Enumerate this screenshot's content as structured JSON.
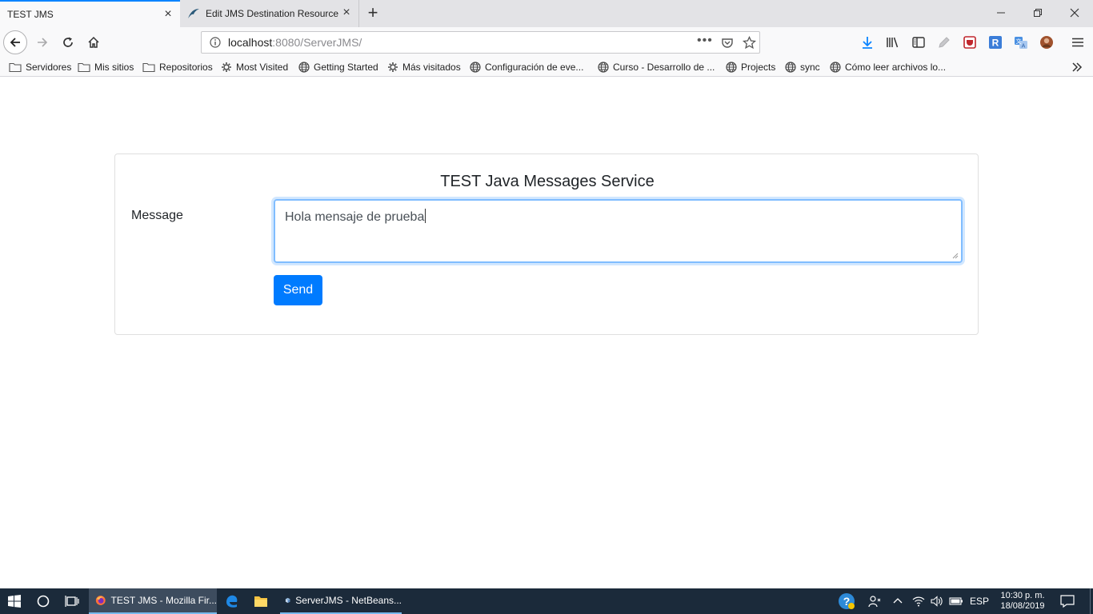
{
  "browser": {
    "tabs": [
      {
        "title": "TEST JMS",
        "active": true
      },
      {
        "title": "Edit JMS Destination Resource",
        "active": false
      }
    ],
    "url": {
      "host": "localhost",
      "rest": ":8080/ServerJMS/"
    },
    "bookmarks": [
      {
        "label": "Servidores",
        "icon": "folder-icon"
      },
      {
        "label": "Mis sitios",
        "icon": "folder-icon"
      },
      {
        "label": "Repositorios",
        "icon": "folder-icon"
      },
      {
        "label": "Most Visited",
        "icon": "gear-icon"
      },
      {
        "label": "Getting Started",
        "icon": "globe-icon"
      },
      {
        "label": "Más visitados",
        "icon": "gear-icon"
      },
      {
        "label": "Configuración de eve...",
        "icon": "globe-icon"
      },
      {
        "label": "Curso - Desarrollo de ...",
        "icon": "globe-icon"
      },
      {
        "label": "Projects",
        "icon": "globe-icon"
      },
      {
        "label": "sync",
        "icon": "globe-icon"
      },
      {
        "label": "Cómo leer archivos lo...",
        "icon": "globe-icon"
      }
    ]
  },
  "page": {
    "title": "TEST Java Messages Service",
    "message_label": "Message",
    "message_value": "Hola mensaje de prueba",
    "send_label": "Send"
  },
  "taskbar": {
    "items": [
      {
        "label": "TEST JMS - Mozilla Fir..."
      },
      {
        "label": "ServerJMS - NetBeans..."
      }
    ],
    "language": "ESP",
    "time": "10:30 p. m.",
    "date": "18/08/2019"
  },
  "colors": {
    "accent": "#007bff",
    "focus_border": "#80bdff",
    "tab_highlight": "#0a84ff",
    "taskbar": "#1b2a3a"
  }
}
